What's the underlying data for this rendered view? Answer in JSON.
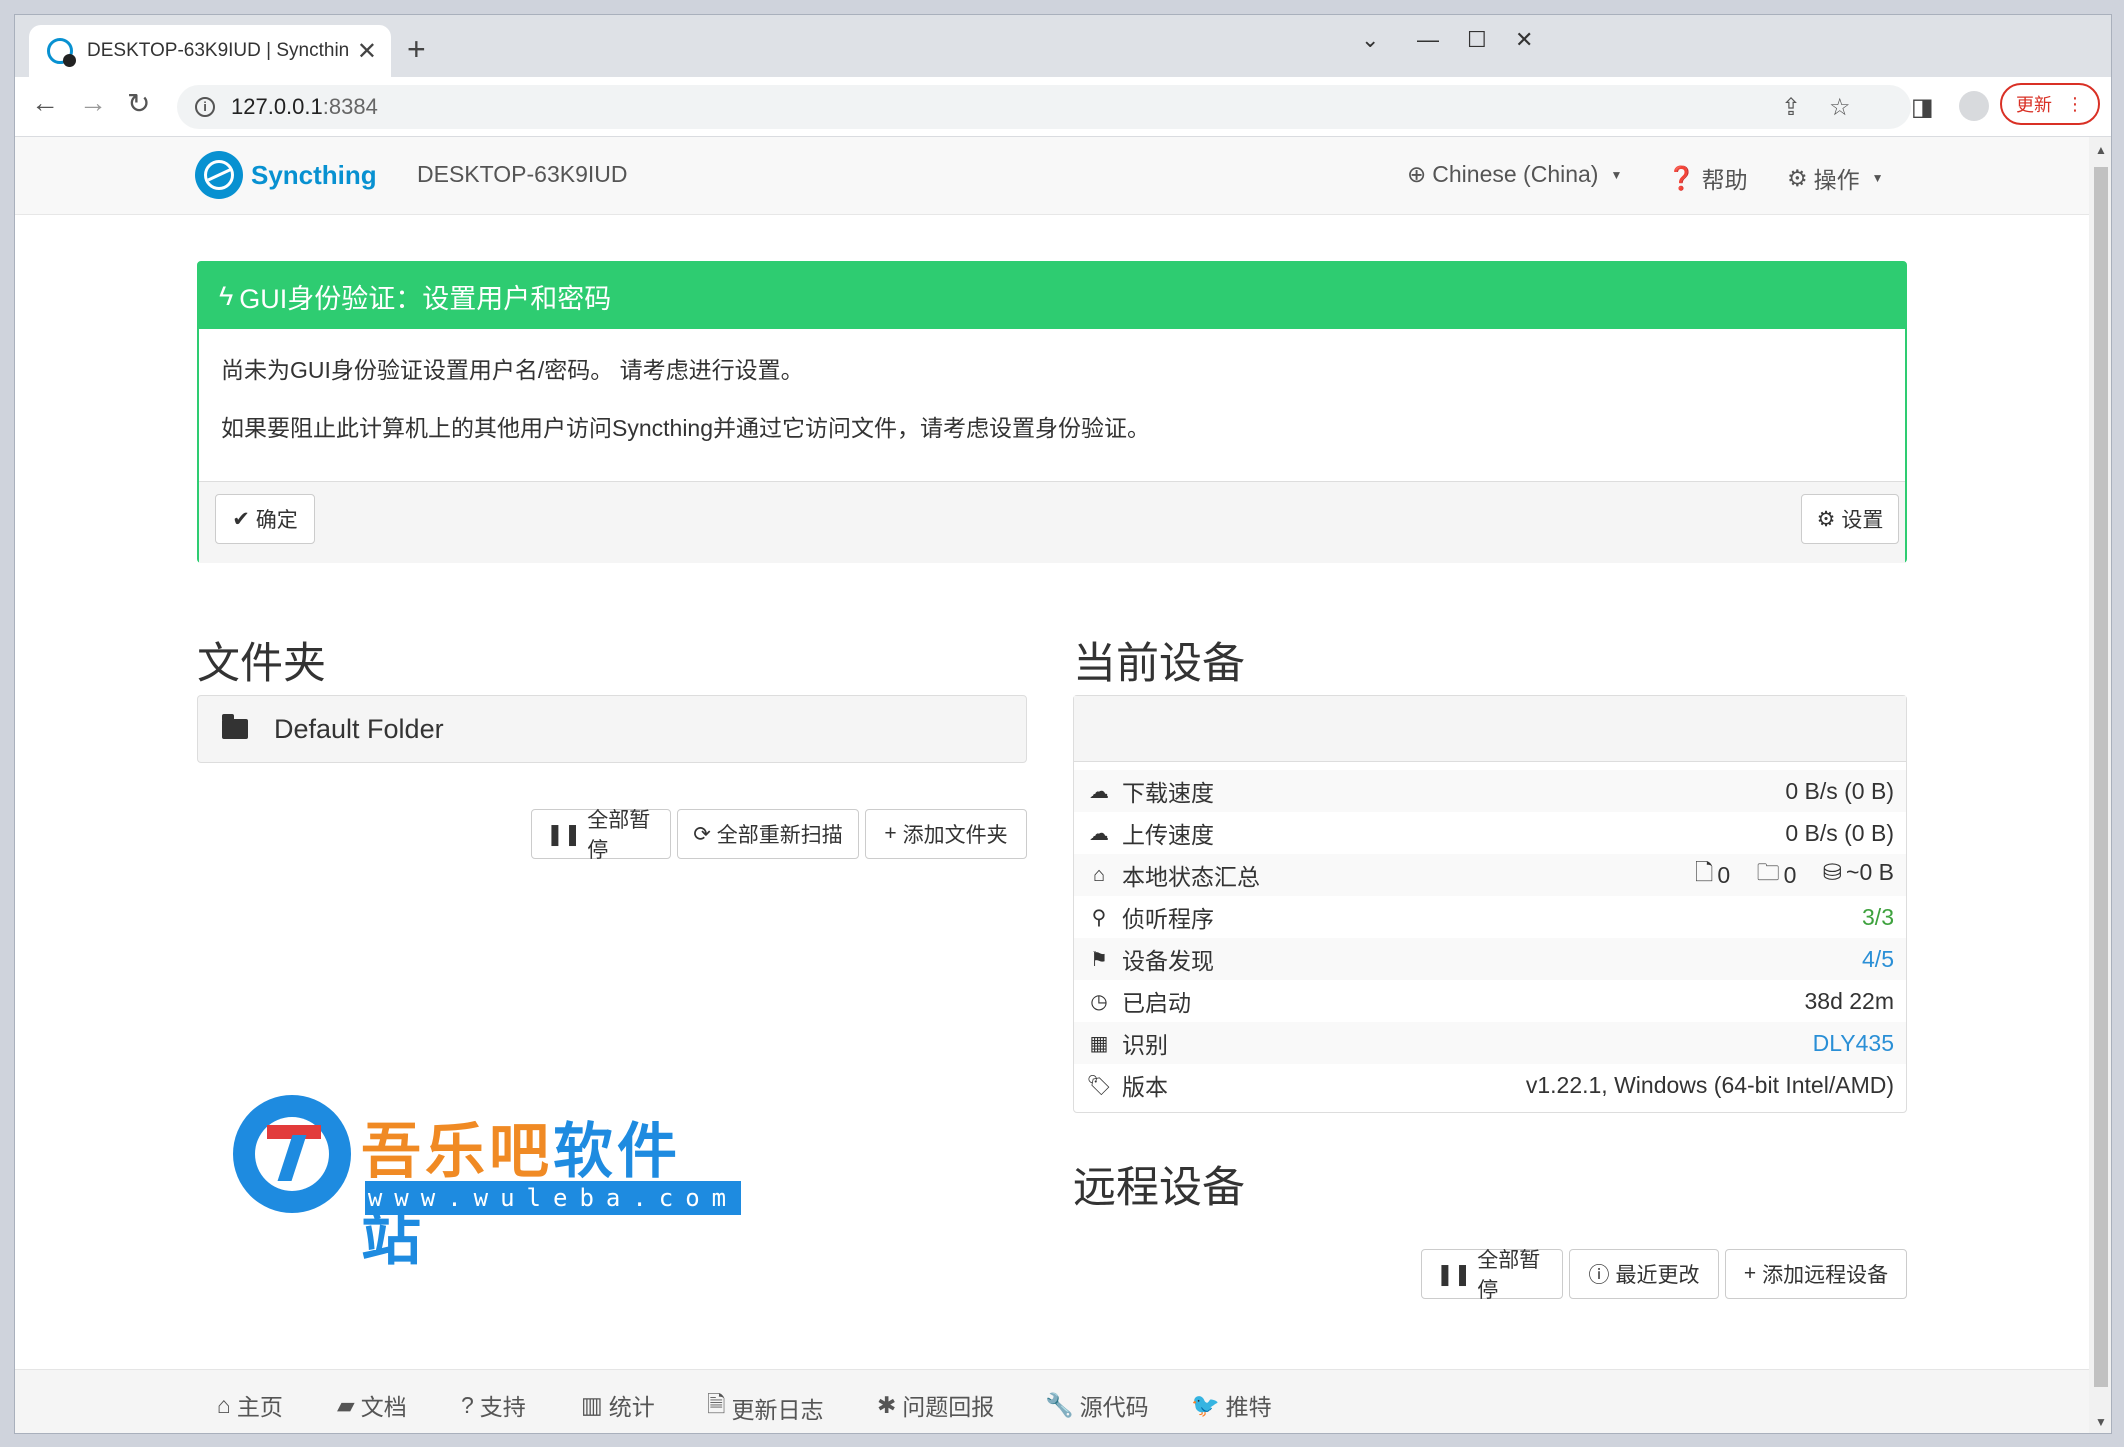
{
  "browser": {
    "tab_title": "DESKTOP-63K9IUD | Syncthing",
    "tab_close": "✕",
    "new_tab": "+",
    "url_host": "127.0.0.1",
    "url_port": ":8384",
    "update_label": "更新"
  },
  "navbar": {
    "brand": "Syncthing",
    "device": "DESKTOP-63K9IUD",
    "language": "Chinese (China)",
    "help": "帮助",
    "actions": "操作"
  },
  "alert": {
    "title": "GUI身份验证：设置用户和密码",
    "line1": "尚未为GUI身份验证设置用户名/密码。 请考虑进行设置。",
    "line2": "如果要阻止此计算机上的其他用户访问Syncthing并通过它访问文件，请考虑设置身份验证。",
    "ok_label": "确定",
    "settings_label": "设置"
  },
  "folders": {
    "heading": "文件夹",
    "items": [
      {
        "name": "Default Folder"
      }
    ],
    "pause_all": "全部暂停",
    "rescan_all": "全部重新扫描",
    "add_folder": "添加文件夹"
  },
  "this_device": {
    "heading": "当前设备",
    "rows": [
      {
        "label": "下载速度",
        "value": "0 B/s (0 B)",
        "icon": "cloud-download-icon"
      },
      {
        "label": "上传速度",
        "value": "0 B/s (0 B)",
        "icon": "cloud-upload-icon"
      },
      {
        "label": "本地状态汇总",
        "files": "0",
        "dirs": "0",
        "size": "~0 B",
        "icon": "home-icon"
      },
      {
        "label": "侦听程序",
        "value": "3/3",
        "icon": "sitemap-icon"
      },
      {
        "label": "设备发现",
        "value": "4/5",
        "icon": "signpost-icon"
      },
      {
        "label": "已启动",
        "value": "38d 22m",
        "icon": "clock-icon"
      },
      {
        "label": "识别",
        "value": "DLY435",
        "icon": "qrcode-icon"
      },
      {
        "label": "版本",
        "value": "v1.22.1, Windows (64-bit Intel/AMD)",
        "icon": "tag-icon"
      }
    ]
  },
  "remote_devices": {
    "heading": "远程设备",
    "pause_all": "全部暂停",
    "recent_changes": "最近更改",
    "add_device": "添加远程设备"
  },
  "watermark": {
    "title_a": "吾乐吧",
    "title_b": "软件站",
    "url": "www.wuleba.com"
  },
  "footer": {
    "links": [
      "主页",
      "文档",
      "支持",
      "统计",
      "更新日志",
      "问题回报",
      "源代码",
      "推特"
    ]
  },
  "colors": {
    "accent": "#0891d1",
    "alert_green": "#2ecc71",
    "value_green": "#3ea23e",
    "value_blue": "#2a8fd6"
  }
}
